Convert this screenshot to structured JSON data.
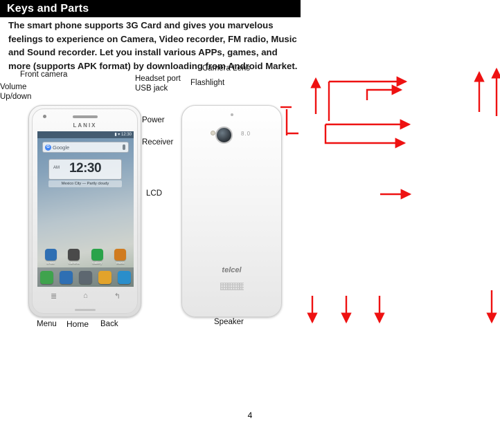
{
  "header": {
    "title": "Keys and Parts"
  },
  "intro": {
    "text": "The smart phone supports 3G Card and gives you marvelous feelings to experience on Camera, Video recorder, FM radio, Music and Sound recorder. Let you install various APPs, games, and more (supports APK format) by downloading from Android Market."
  },
  "labels": {
    "front_camera": "Front camera",
    "volume": "Volume",
    "up_down": "Up/down",
    "headset_port": "Headset port",
    "usb_jack": "USB jack",
    "camera_lens": "Camera Lens",
    "flashlight": "Flashlight",
    "power": "Power",
    "receiver": "Receiver",
    "lcd": "LCD",
    "menu": "Menu",
    "home": "Home",
    "back": "Back",
    "speaker": "Speaker"
  },
  "phone_front": {
    "brand": "LANIX",
    "status_right": "▮ ▾ 12:30",
    "search_placeholder": "Google",
    "search_g": "G",
    "clock_time": "12:30",
    "clock_ampm": "AM",
    "weather": "Mexico City  —  Partly cloudy",
    "dock_apps": [
      {
        "name": "Email",
        "color": "#2f6fb3"
      },
      {
        "name": "Camera",
        "color": "#4a4a4a"
      },
      {
        "name": "Gallery",
        "color": "#2aa34a"
      },
      {
        "name": "Music",
        "color": "#d07b1f"
      }
    ],
    "tray_icons": [
      {
        "name": "phone",
        "color": "#3fa34d"
      },
      {
        "name": "contacts",
        "color": "#2f6fb3"
      },
      {
        "name": "apps",
        "color": "#5d6770"
      },
      {
        "name": "messaging",
        "color": "#e2a32b"
      },
      {
        "name": "browser",
        "color": "#2a8ecb"
      }
    ],
    "nav_icons": [
      "≣",
      "⌂",
      "↰"
    ]
  },
  "phone_back": {
    "megapixels": "8.0",
    "brand_logo": "telcel"
  },
  "footer": {
    "page_number": "4"
  },
  "colors": {
    "arrow_red": "#ee1111",
    "header_bg": "#000000",
    "header_text": "#ffffff"
  }
}
